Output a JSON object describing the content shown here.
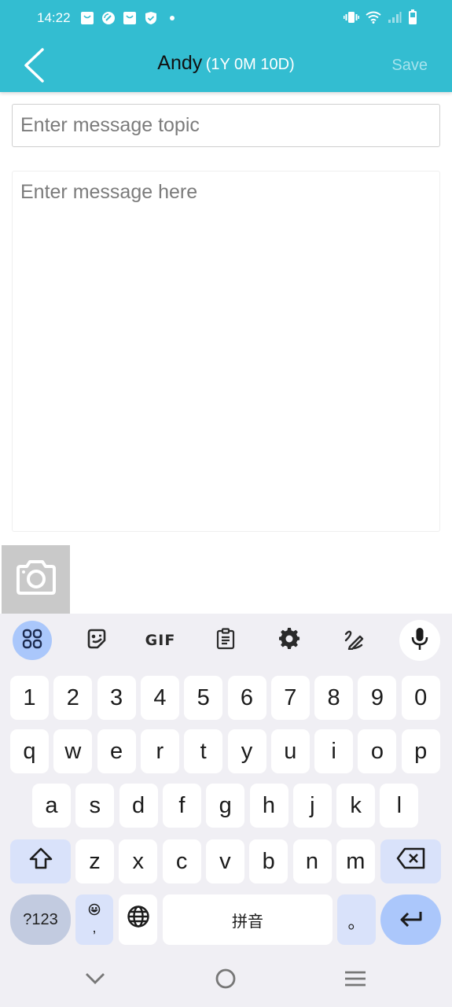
{
  "status_bar": {
    "time": "14:22",
    "left_icons": [
      "shopping-bag-icon",
      "speedometer-icon",
      "shopping-bag-icon",
      "shield-check-icon",
      "dot-icon"
    ],
    "right_icons": [
      "vibrate-icon",
      "wifi-icon",
      "signal-icon",
      "battery-icon"
    ]
  },
  "header": {
    "back_icon": "chevron-left-icon",
    "title_name": "Andy",
    "title_age": "(1Y 0M 10D)",
    "save_label": "Save",
    "background_color": "#33bdd1"
  },
  "form": {
    "topic": {
      "value": "",
      "placeholder": "Enter message topic"
    },
    "message": {
      "value": "",
      "placeholder": "Enter message here"
    },
    "camera_icon": "camera-icon"
  },
  "keyboard": {
    "toolbar": [
      {
        "name": "apps-grid-icon",
        "active": true
      },
      {
        "name": "sticker-icon"
      },
      {
        "name": "gif-button",
        "label": "GIF"
      },
      {
        "name": "clipboard-icon"
      },
      {
        "name": "settings-gear-icon"
      },
      {
        "name": "handwriting-icon"
      },
      {
        "name": "microphone-icon"
      }
    ],
    "row_numbers": [
      "1",
      "2",
      "3",
      "4",
      "5",
      "6",
      "7",
      "8",
      "9",
      "0"
    ],
    "row_top": [
      "q",
      "w",
      "e",
      "r",
      "t",
      "y",
      "u",
      "i",
      "o",
      "p"
    ],
    "row_middle": [
      "a",
      "s",
      "d",
      "f",
      "g",
      "h",
      "j",
      "k",
      "l"
    ],
    "row_bottom": [
      "z",
      "x",
      "c",
      "v",
      "b",
      "n",
      "m"
    ],
    "symbols_label": "?123",
    "comma_label": ",",
    "space_label": "拼音",
    "period_label": "。"
  },
  "nav_bar": {
    "buttons": [
      "chevron-down-icon",
      "home-circle-icon",
      "menu-lines-icon"
    ]
  }
}
